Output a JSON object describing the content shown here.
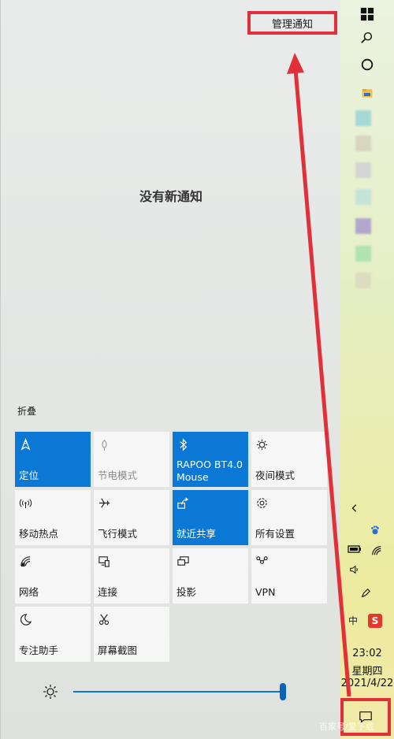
{
  "action_center": {
    "manage_notifications": "管理通知",
    "empty_message": "没有新通知",
    "collapse_label": "折叠",
    "quick_actions": [
      {
        "label": "定位",
        "icon": "location-icon",
        "state": "on"
      },
      {
        "label": "节电模式",
        "icon": "battery-saver-icon",
        "state": "disabled"
      },
      {
        "label": "RAPOO BT4.0 Mouse",
        "icon": "bluetooth-icon",
        "state": "on"
      },
      {
        "label": "夜间模式",
        "icon": "night-light-icon",
        "state": "off"
      },
      {
        "label": "移动热点",
        "icon": "mobile-hotspot-icon",
        "state": "off"
      },
      {
        "label": "飞行模式",
        "icon": "airplane-icon",
        "state": "off"
      },
      {
        "label": "就近共享",
        "icon": "nearby-share-icon",
        "state": "on"
      },
      {
        "label": "所有设置",
        "icon": "settings-icon",
        "state": "off"
      },
      {
        "label": "网络",
        "icon": "network-icon",
        "state": "off"
      },
      {
        "label": "连接",
        "icon": "connect-icon",
        "state": "off"
      },
      {
        "label": "投影",
        "icon": "project-icon",
        "state": "off"
      },
      {
        "label": "VPN",
        "icon": "vpn-icon",
        "state": "off"
      },
      {
        "label": "专注助手",
        "icon": "focus-assist-icon",
        "state": "off"
      },
      {
        "label": "屏幕截图",
        "icon": "screen-snip-icon",
        "state": "off"
      }
    ],
    "brightness_level": 1.0
  },
  "taskbar": {
    "time": "23:02",
    "weekday": "星期四",
    "date": "2021/4/22",
    "ime_label": "中",
    "watermark": "百家号/爱下载"
  },
  "colors": {
    "accent": "#0a78d4",
    "highlight": "#e0313a"
  }
}
